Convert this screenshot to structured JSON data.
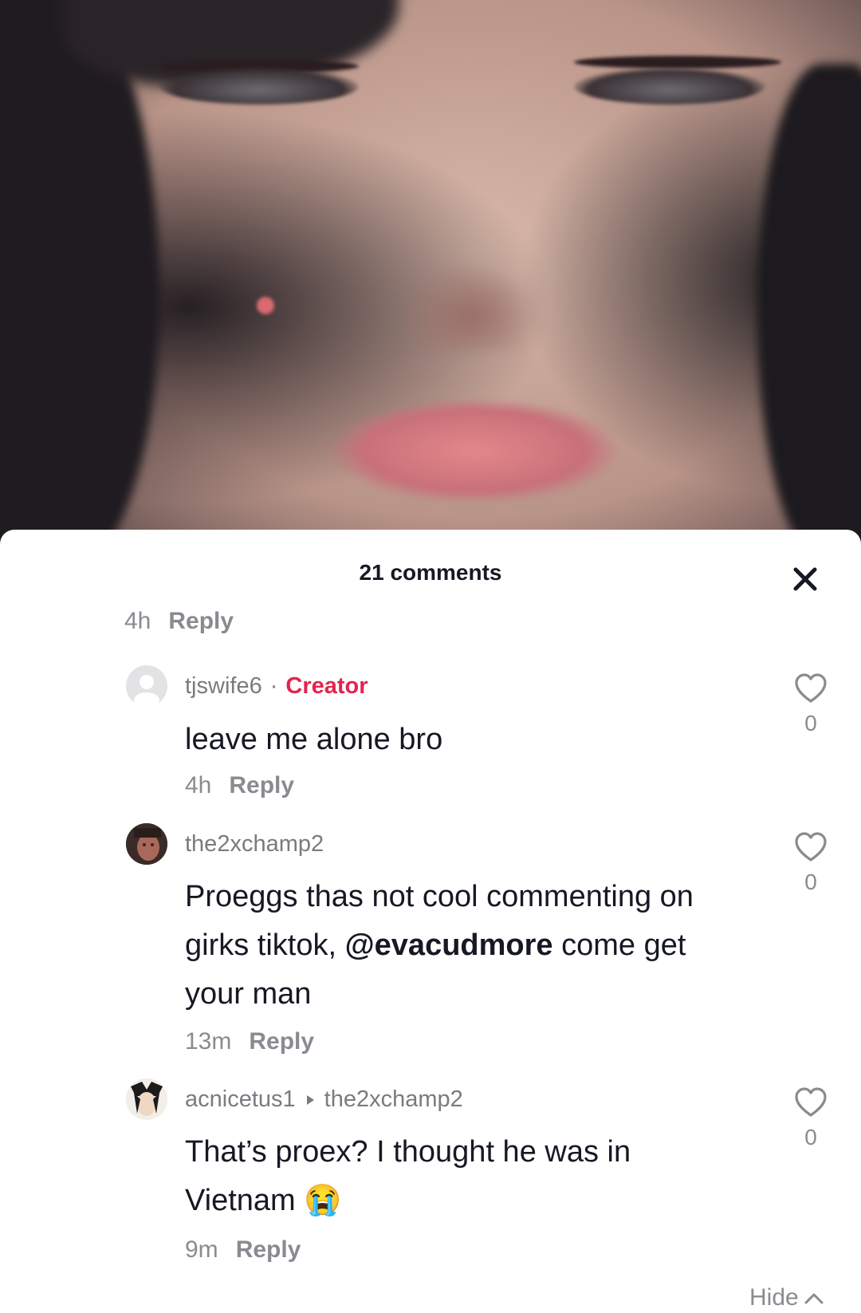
{
  "sheet": {
    "title": "21 comments",
    "close_icon": "close-icon"
  },
  "previous_meta": {
    "time": "4h",
    "reply": "Reply"
  },
  "comments": [
    {
      "username": "tjswife6",
      "separator": "·",
      "badge": "Creator",
      "text": "leave me alone bro",
      "time": "4h",
      "reply": "Reply",
      "likes": "0",
      "avatar": "default-avatar"
    },
    {
      "username": "the2xchamp2",
      "text_before": "Proeggs thas not cool commenting on girks tiktok, ",
      "mention": "@evacudmore",
      "text_after": " come get your man",
      "time": "13m",
      "reply": "Reply",
      "likes": "0",
      "avatar": "user-photo-avatar"
    },
    {
      "username": "acnicetus1",
      "reply_to": "the2xchamp2",
      "text": "That’s proex? I thought he was in Vietnam",
      "emoji": "😭",
      "time": "9m",
      "reply": "Reply",
      "likes": "0",
      "avatar": "anime-avatar"
    }
  ],
  "footer": {
    "hide": "Hide"
  },
  "colors": {
    "creator": "#e2244e",
    "text": "#161823",
    "muted": "#8a8b91"
  }
}
